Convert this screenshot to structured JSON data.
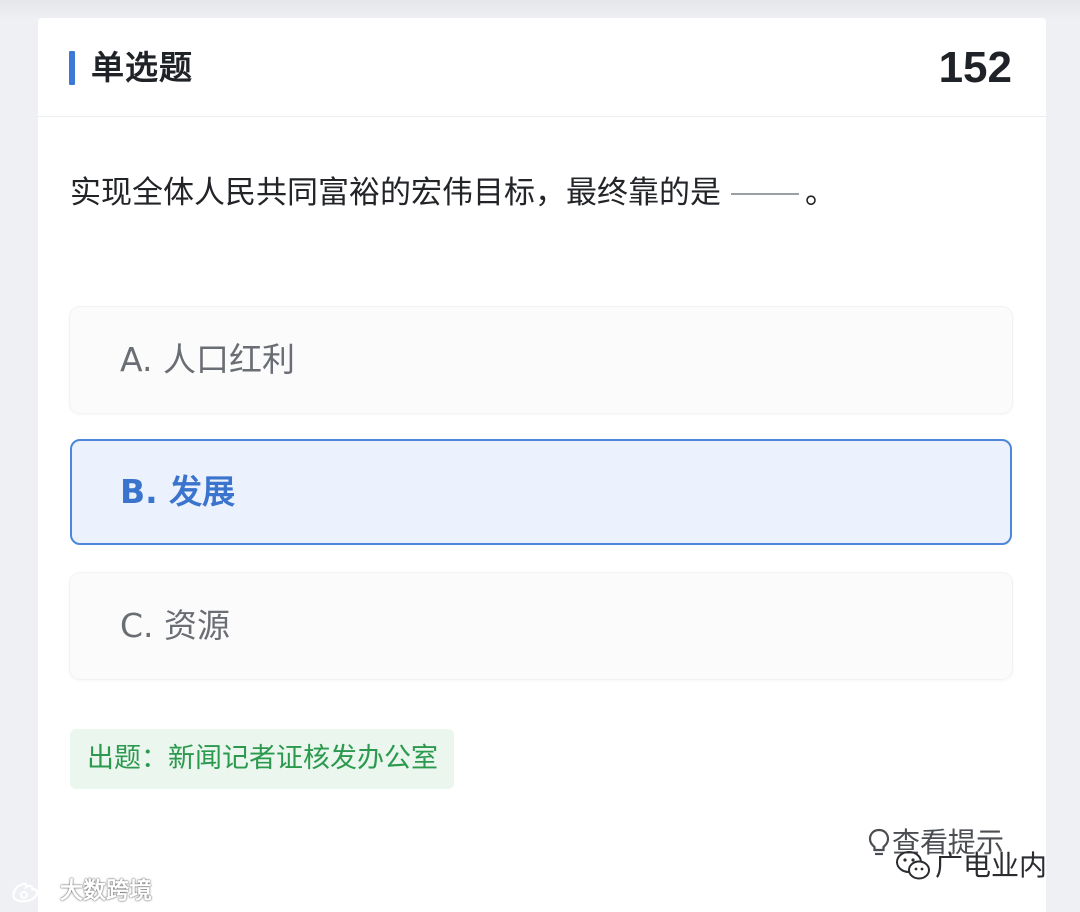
{
  "header": {
    "title": "单选题",
    "question_number": "152"
  },
  "question": {
    "text": "实现全体人民共同富裕的宏伟目标，最终靠的是",
    "end_punct": "。"
  },
  "options": [
    {
      "label": "A. 人口红利",
      "selected": false
    },
    {
      "label": "B. 发展",
      "selected": true
    },
    {
      "label": "C. 资源",
      "selected": false
    }
  ],
  "source": "出题：新闻记者证核发办公室",
  "hint_link": "查看提示",
  "watermarks": {
    "right": "广电业内",
    "left": "大数跨境"
  },
  "colors": {
    "accent": "#3d78d8",
    "selected_bg": "#ebf1fd",
    "selected_border": "#4d87d9",
    "source_text": "#2c9a4e",
    "source_bg": "#eaf6ee"
  }
}
